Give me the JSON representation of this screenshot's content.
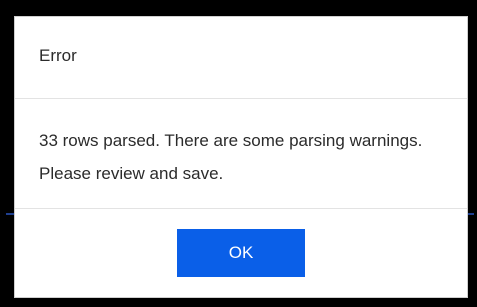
{
  "dialog": {
    "title": "Error",
    "message": "33 rows parsed. There are some parsing warnings. Please review and save.",
    "ok_label": "OK"
  },
  "colors": {
    "primary_button": "#0a5fe8",
    "overlay": "#000000",
    "dialog_background": "#ffffff"
  }
}
